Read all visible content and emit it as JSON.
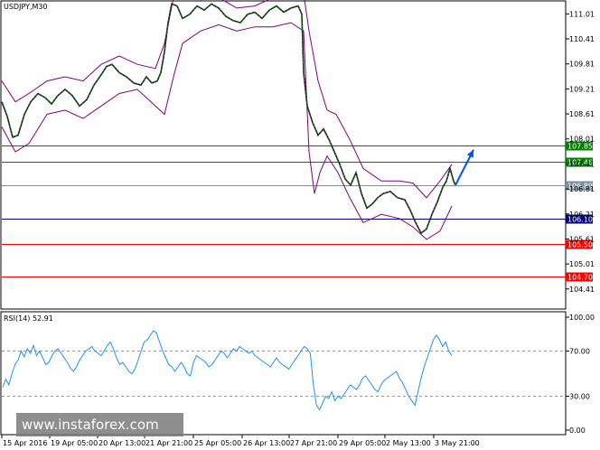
{
  "chart_data": [
    {
      "type": "candlestick",
      "symbol": "USDJPY,M30",
      "price_axis_labels": [
        "111.01",
        "110.41",
        "109.81",
        "109.21",
        "108.61",
        "108.01",
        "107.41",
        "106.81",
        "106.21",
        "105.61",
        "105.01",
        "104.41"
      ],
      "time_axis_labels": [
        "15 Apr 2016",
        "19 Apr 05:00",
        "20 Apr 13:00",
        "21 Apr 21:00",
        "25 Apr 05:00",
        "26 Apr 13:00",
        "27 Apr 21:00",
        "29 Apr 05:00",
        "2 May 13:00",
        "3 May 21:00"
      ],
      "ylim": [
        103.95,
        111.3
      ],
      "price_path": [
        [
          0,
          108.9
        ],
        [
          6,
          108.55
        ],
        [
          12,
          108.05
        ],
        [
          18,
          108.1
        ],
        [
          25,
          108.6
        ],
        [
          32,
          108.9
        ],
        [
          40,
          109.1
        ],
        [
          48,
          109.0
        ],
        [
          55,
          108.85
        ],
        [
          62,
          109.05
        ],
        [
          70,
          109.2
        ],
        [
          78,
          109.05
        ],
        [
          86,
          108.8
        ],
        [
          94,
          108.95
        ],
        [
          102,
          109.3
        ],
        [
          110,
          109.55
        ],
        [
          116,
          109.75
        ],
        [
          122,
          109.8
        ],
        [
          130,
          109.6
        ],
        [
          138,
          109.5
        ],
        [
          146,
          109.35
        ],
        [
          154,
          109.3
        ],
        [
          160,
          109.5
        ],
        [
          166,
          109.35
        ],
        [
          172,
          109.4
        ],
        [
          176,
          109.6
        ],
        [
          180,
          110.1
        ],
        [
          184,
          110.8
        ],
        [
          188,
          111.25
        ],
        [
          194,
          111.2
        ],
        [
          200,
          110.9
        ],
        [
          208,
          111.0
        ],
        [
          216,
          111.2
        ],
        [
          224,
          111.1
        ],
        [
          232,
          111.25
        ],
        [
          240,
          111.15
        ],
        [
          248,
          110.95
        ],
        [
          256,
          110.85
        ],
        [
          264,
          110.8
        ],
        [
          272,
          111.0
        ],
        [
          280,
          111.05
        ],
        [
          288,
          110.9
        ],
        [
          296,
          111.1
        ],
        [
          304,
          111.2
        ],
        [
          312,
          111.05
        ],
        [
          320,
          111.15
        ],
        [
          328,
          111.2
        ],
        [
          332,
          111.0
        ],
        [
          334,
          109.6
        ],
        [
          338,
          108.8
        ],
        [
          344,
          108.4
        ],
        [
          350,
          108.1
        ],
        [
          356,
          108.25
        ],
        [
          362,
          108.0
        ],
        [
          368,
          107.7
        ],
        [
          374,
          107.4
        ],
        [
          380,
          107.05
        ],
        [
          386,
          106.9
        ],
        [
          392,
          107.2
        ],
        [
          398,
          106.7
        ],
        [
          404,
          106.35
        ],
        [
          410,
          106.45
        ],
        [
          416,
          106.6
        ],
        [
          422,
          106.7
        ],
        [
          430,
          106.75
        ],
        [
          438,
          106.6
        ],
        [
          446,
          106.55
        ],
        [
          452,
          106.3
        ],
        [
          458,
          106.0
        ],
        [
          464,
          105.75
        ],
        [
          470,
          105.85
        ],
        [
          476,
          106.2
        ],
        [
          482,
          106.5
        ],
        [
          488,
          106.85
        ],
        [
          492,
          107.0
        ],
        [
          496,
          107.3
        ],
        [
          500,
          107.0
        ],
        [
          502,
          106.9
        ]
      ],
      "upper_band_path": [
        [
          0,
          109.4
        ],
        [
          15,
          108.9
        ],
        [
          30,
          109.1
        ],
        [
          50,
          109.4
        ],
        [
          70,
          109.5
        ],
        [
          90,
          109.4
        ],
        [
          110,
          109.8
        ],
        [
          130,
          110.0
        ],
        [
          150,
          109.8
        ],
        [
          170,
          109.7
        ],
        [
          180,
          110.3
        ],
        [
          190,
          111.4
        ],
        [
          200,
          111.5
        ],
        [
          220,
          111.35
        ],
        [
          240,
          111.4
        ],
        [
          260,
          111.15
        ],
        [
          280,
          111.2
        ],
        [
          300,
          111.4
        ],
        [
          320,
          111.45
        ],
        [
          334,
          111.5
        ],
        [
          340,
          110.6
        ],
        [
          350,
          109.4
        ],
        [
          360,
          108.7
        ],
        [
          370,
          108.6
        ],
        [
          385,
          108.0
        ],
        [
          400,
          107.3
        ],
        [
          420,
          107.0
        ],
        [
          440,
          107.0
        ],
        [
          455,
          106.95
        ],
        [
          470,
          106.6
        ],
        [
          485,
          107.0
        ],
        [
          498,
          107.4
        ]
      ],
      "lower_band_path": [
        [
          0,
          108.3
        ],
        [
          15,
          107.7
        ],
        [
          30,
          107.9
        ],
        [
          50,
          108.6
        ],
        [
          70,
          108.7
        ],
        [
          90,
          108.5
        ],
        [
          110,
          108.8
        ],
        [
          130,
          109.1
        ],
        [
          150,
          109.2
        ],
        [
          170,
          108.8
        ],
        [
          180,
          108.6
        ],
        [
          190,
          109.5
        ],
        [
          200,
          110.3
        ],
        [
          220,
          110.6
        ],
        [
          240,
          110.75
        ],
        [
          260,
          110.6
        ],
        [
          280,
          110.7
        ],
        [
          300,
          110.7
        ],
        [
          320,
          110.8
        ],
        [
          334,
          110.6
        ],
        [
          340,
          107.7
        ],
        [
          346,
          106.7
        ],
        [
          352,
          107.2
        ],
        [
          360,
          107.6
        ],
        [
          372,
          107.2
        ],
        [
          385,
          106.6
        ],
        [
          400,
          106.0
        ],
        [
          420,
          106.2
        ],
        [
          440,
          106.1
        ],
        [
          455,
          105.9
        ],
        [
          470,
          105.6
        ],
        [
          485,
          105.8
        ],
        [
          498,
          106.4
        ]
      ],
      "levels": [
        {
          "label": "107.85",
          "value": 107.85,
          "color": "#008000"
        },
        {
          "label": "107.46",
          "value": 107.46,
          "color": "#008000"
        },
        {
          "label": "106.89",
          "value": 106.89,
          "color": "#7f8fa0"
        },
        {
          "label": "106.10",
          "value": 106.1,
          "color": "#000080"
        },
        {
          "label": "105.50",
          "value": 105.5,
          "color": "#ff0000"
        },
        {
          "label": "104.70",
          "value": 104.7,
          "color": "#ff0000"
        }
      ],
      "arrow_color": "#0050ff"
    },
    {
      "type": "line",
      "name": "RSI(14) 52.91",
      "yticks": [
        "100.00",
        "70.00",
        "30.00",
        "0.00"
      ],
      "ylim": [
        0,
        100
      ],
      "levels": [
        70,
        30
      ],
      "series_color": "#1e90ff",
      "values": [
        38,
        45,
        40,
        50,
        58,
        62,
        70,
        65,
        72,
        68,
        75,
        66,
        70,
        64,
        58,
        60,
        66,
        70,
        72,
        68,
        64,
        60,
        55,
        52,
        56,
        62,
        66,
        70,
        72,
        74,
        70,
        68,
        66,
        70,
        75,
        78,
        72,
        64,
        58,
        60,
        56,
        52,
        50,
        54,
        62,
        70,
        78,
        80,
        84,
        88,
        86,
        78,
        70,
        64,
        58,
        56,
        52,
        56,
        60,
        56,
        50,
        48,
        60,
        66,
        64,
        62,
        60,
        56,
        58,
        62,
        66,
        70,
        68,
        64,
        68,
        72,
        70,
        74,
        72,
        70,
        68,
        70,
        66,
        64,
        62,
        60,
        58,
        56,
        60,
        64,
        60,
        58,
        56,
        54,
        58,
        62,
        66,
        70,
        74,
        72,
        68,
        40,
        22,
        18,
        24,
        30,
        28,
        34,
        26,
        30,
        28,
        32,
        36,
        40,
        38,
        36,
        40,
        46,
        48,
        44,
        40,
        36,
        34,
        40,
        44,
        46,
        48,
        50,
        52,
        46,
        42,
        36,
        30,
        26,
        22,
        34,
        46,
        56,
        64,
        72,
        80,
        84,
        80,
        74,
        78,
        70,
        66
      ]
    }
  ],
  "watermark": "www.instaforex.com"
}
